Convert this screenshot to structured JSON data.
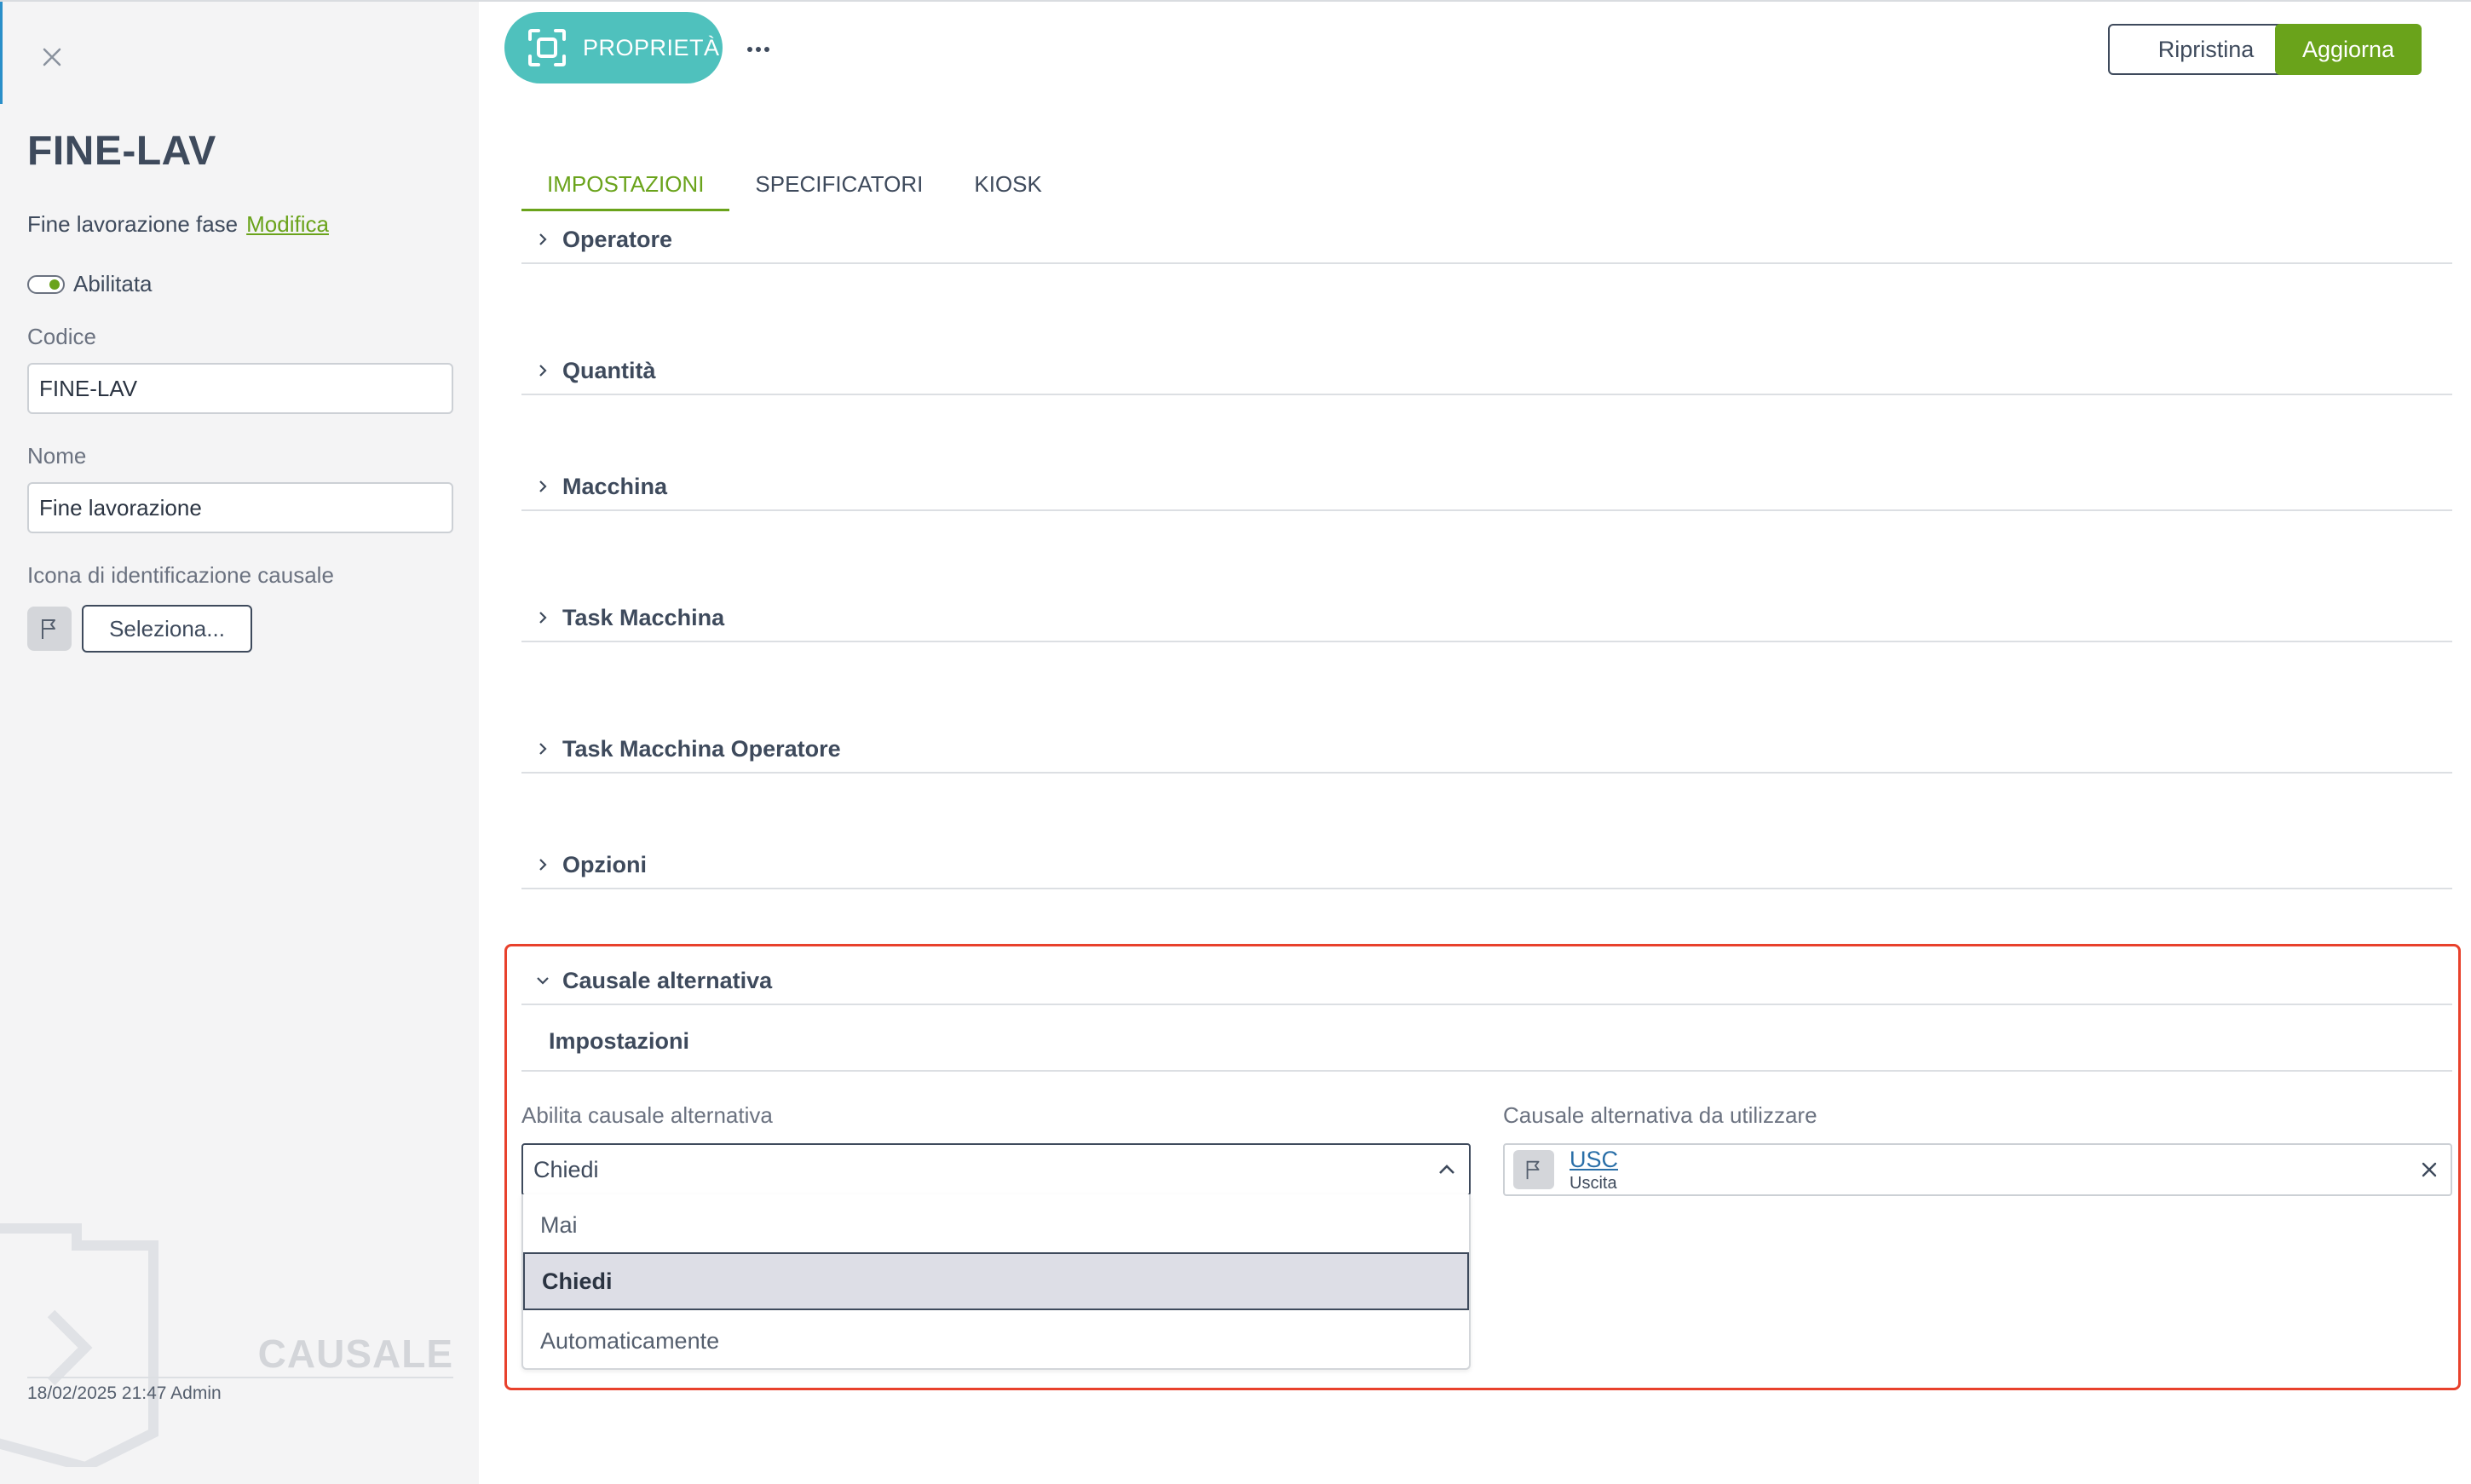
{
  "sidebar": {
    "title": "FINE-LAV",
    "description": "Fine lavorazione fase",
    "edit_link": "Modifica",
    "enabled_label": "Abilitata",
    "code_label": "Codice",
    "code_value": "FINE-LAV",
    "name_label": "Nome",
    "name_value": "Fine lavorazione",
    "icon_label": "Icona di identificazione causale",
    "select_button": "Seleziona...",
    "watermark": "CAUSALE",
    "footer": "18/02/2025 21:47 Admin"
  },
  "toolbar": {
    "properties_label": "PROPRIETÀ",
    "reset_label": "Ripristina",
    "update_label": "Aggiorna"
  },
  "tabs": [
    {
      "label": "IMPOSTAZIONI",
      "active": true
    },
    {
      "label": "SPECIFICATORI",
      "active": false
    },
    {
      "label": "KIOSK",
      "active": false
    }
  ],
  "sections": [
    {
      "label": "Operatore",
      "expanded": false
    },
    {
      "label": "Quantità",
      "expanded": false
    },
    {
      "label": "Macchina",
      "expanded": false
    },
    {
      "label": "Task Macchina",
      "expanded": false
    },
    {
      "label": "Task Macchina Operatore",
      "expanded": false
    },
    {
      "label": "Opzioni",
      "expanded": false
    },
    {
      "label": "Causale alternativa",
      "expanded": true
    }
  ],
  "alt_cause": {
    "subheader": "Impostazioni",
    "enable_label": "Abilita causale alternativa",
    "enable_value": "Chiedi",
    "options": [
      "Mai",
      "Chiedi",
      "Automaticamente"
    ],
    "selected_option": "Chiedi",
    "use_label": "Causale alternativa da utilizzare",
    "use_code": "USC",
    "use_name": "Uscita"
  },
  "colors": {
    "accent_green": "#6aa31b",
    "teal": "#4fc1bd",
    "highlight_red": "#e8412c"
  }
}
